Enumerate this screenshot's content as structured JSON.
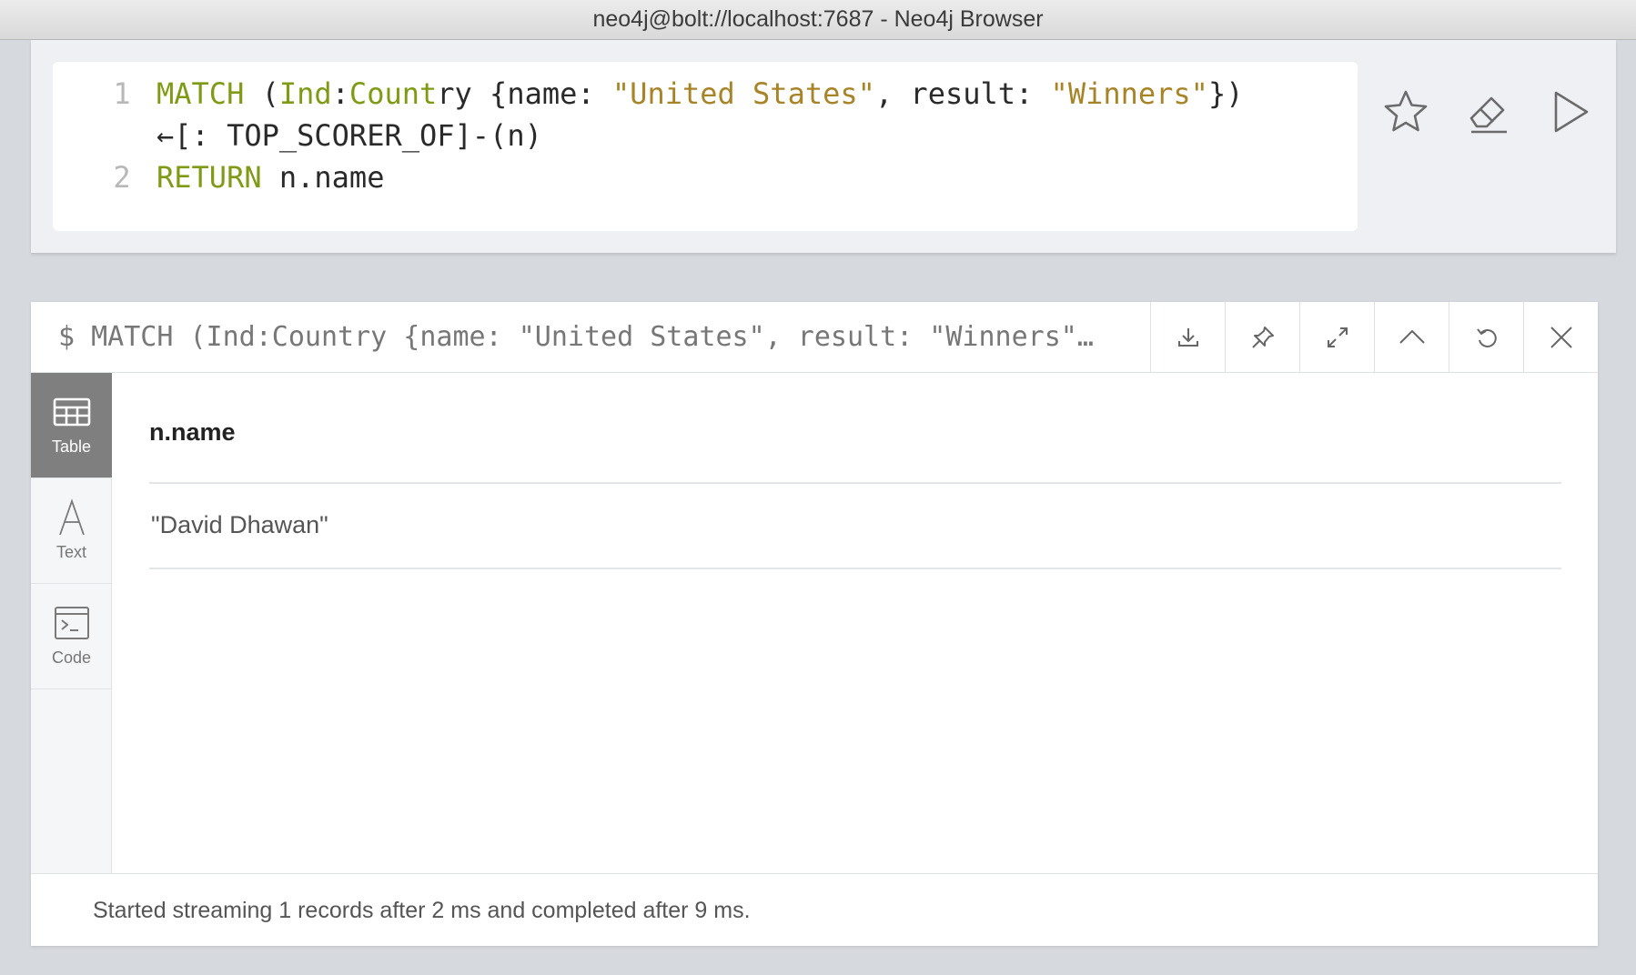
{
  "window": {
    "title": "neo4j@bolt://localhost:7687 - Neo4j Browser"
  },
  "editor": {
    "lines": [
      {
        "number": "1",
        "tokens": [
          {
            "text": "MATCH",
            "kind": "keyword"
          },
          {
            "text": " (",
            "kind": "plain"
          },
          {
            "text": "Ind",
            "kind": "label"
          },
          {
            "text": ":",
            "kind": "plain"
          },
          {
            "text": "Count",
            "kind": "label"
          },
          {
            "text": "ry {name: ",
            "kind": "plain"
          },
          {
            "text": "\"United States\"",
            "kind": "string"
          },
          {
            "text": ", result: ",
            "kind": "plain"
          },
          {
            "text": "\"Winners\"",
            "kind": "string"
          },
          {
            "text": "})",
            "kind": "plain"
          }
        ]
      },
      {
        "number": "",
        "tokens": [
          {
            "text": "←[: TOP_SCORER_OF]-(n)",
            "kind": "plain"
          }
        ]
      },
      {
        "number": "2",
        "tokens": [
          {
            "text": "RETURN",
            "kind": "keyword"
          },
          {
            "text": " n.name",
            "kind": "plain"
          }
        ]
      }
    ],
    "actions": [
      {
        "name": "favorite-button",
        "icon": "star-icon"
      },
      {
        "name": "clear-editor-button",
        "icon": "eraser-icon"
      },
      {
        "name": "run-query-button",
        "icon": "play-icon"
      }
    ]
  },
  "frame": {
    "query": "$ MATCH (Ind:Country {name: \"United States\", result: \"Winners\"…",
    "buttons": [
      {
        "name": "download-button",
        "icon": "download-icon"
      },
      {
        "name": "pin-button",
        "icon": "pin-icon"
      },
      {
        "name": "fullscreen-button",
        "icon": "expand-icon"
      },
      {
        "name": "collapse-button",
        "icon": "chevron-up-icon"
      },
      {
        "name": "rerun-button",
        "icon": "refresh-icon"
      },
      {
        "name": "close-button",
        "icon": "close-icon"
      }
    ],
    "views": [
      {
        "label": "Table",
        "icon": "table-icon",
        "active": true
      },
      {
        "label": "Text",
        "icon": "text-icon",
        "active": false
      },
      {
        "label": "Code",
        "icon": "code-icon",
        "active": false
      }
    ],
    "table": {
      "columns": [
        "n.name"
      ],
      "rows": [
        [
          "\"David Dhawan\""
        ]
      ]
    },
    "status": "Started streaming 1 records after 2 ms and completed after 9 ms."
  }
}
